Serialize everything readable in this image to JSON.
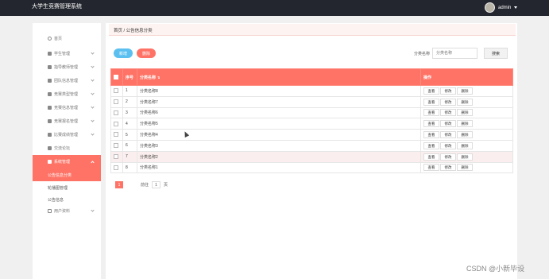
{
  "header": {
    "app_title": "大学生竞赛管理系统",
    "user_name": "admin"
  },
  "sidebar": {
    "items": [
      {
        "label": "首页"
      },
      {
        "label": "学生管理"
      },
      {
        "label": "指导教师管理"
      },
      {
        "label": "团队信息管理"
      },
      {
        "label": "竞赛类型管理"
      },
      {
        "label": "竞赛信息管理"
      },
      {
        "label": "竞赛报名管理"
      },
      {
        "label": "比赛成绩管理"
      },
      {
        "label": "交流论坛"
      },
      {
        "label": "系统管理"
      }
    ],
    "sub_items": [
      {
        "label": "公告信息分类"
      },
      {
        "label": "轮播图管理"
      },
      {
        "label": "公告信息"
      }
    ],
    "last_item": {
      "label": "用户资料"
    }
  },
  "breadcrumb": "首页 / 公告信息分类",
  "toolbar": {
    "add_label": "新增",
    "delete_label": "删除",
    "search_label": "分类名称",
    "search_placeholder": "分类名称",
    "search_button": "搜索"
  },
  "table": {
    "columns": [
      "序号",
      "分类名称",
      "操作"
    ],
    "actions": [
      "查看",
      "修改",
      "删除"
    ],
    "rows": [
      {
        "index": "1",
        "name": "分类名称8"
      },
      {
        "index": "2",
        "name": "分类名称7"
      },
      {
        "index": "3",
        "name": "分类名称6"
      },
      {
        "index": "4",
        "name": "分类名称5"
      },
      {
        "index": "5",
        "name": "分类名称4"
      },
      {
        "index": "6",
        "name": "分类名称3"
      },
      {
        "index": "7",
        "name": "分类名称2"
      },
      {
        "index": "8",
        "name": "分类名称1"
      }
    ]
  },
  "pager": {
    "current_page": "1",
    "goto_label": "前往",
    "goto_value": "1",
    "page_suffix": "页"
  },
  "watermark": "CSDN @小新毕设"
}
